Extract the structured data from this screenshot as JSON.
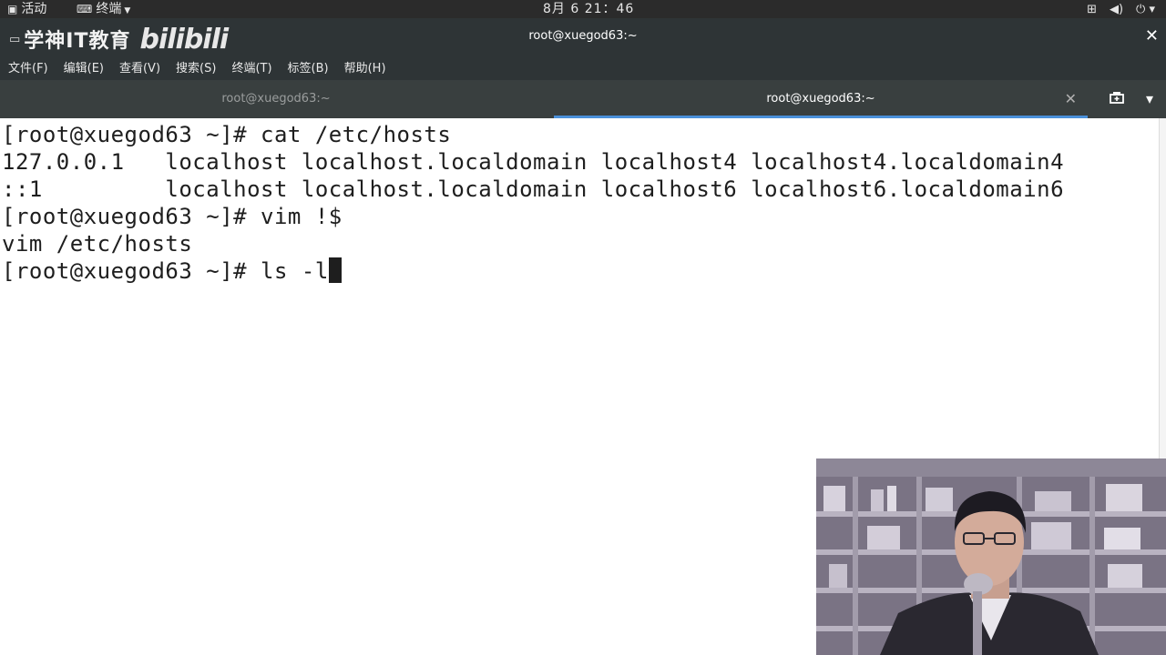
{
  "topbar": {
    "activities": "活动",
    "app_menu": "终端",
    "clock": "8月 6  21：46",
    "tray_icons": [
      "network-icon",
      "volume-icon",
      "power-icon"
    ]
  },
  "window": {
    "watermark_text": "学神IT教育",
    "watermark_logo": "bilibili",
    "title": "root@xuegod63:~",
    "close": "✕"
  },
  "menubar": {
    "items": [
      "文件(F)",
      "编辑(E)",
      "查看(V)",
      "搜索(S)",
      "终端(T)",
      "标签(B)",
      "帮助(H)"
    ]
  },
  "tabs": [
    {
      "label": "root@xuegod63:~",
      "active": false
    },
    {
      "label": "root@xuegod63:~",
      "active": true
    }
  ],
  "terminal": {
    "lines": [
      "[root@xuegod63 ~]# cat /etc/hosts",
      "127.0.0.1   localhost localhost.localdomain localhost4 localhost4.localdomain4",
      "::1         localhost localhost.localdomain localhost6 localhost6.localdomain6",
      "[root@xuegod63 ~]# vim !$",
      "vim /etc/hosts",
      "[root@xuegod63 ~]# ls -l"
    ]
  },
  "colors": {
    "topbar_bg": "#2b2b2b",
    "header_bg": "#2e3436",
    "tabbar_bg": "#393f3f",
    "active_tab_indicator": "#4a90d9",
    "terminal_bg": "#ffffff",
    "terminal_fg": "#1e1e1e"
  }
}
